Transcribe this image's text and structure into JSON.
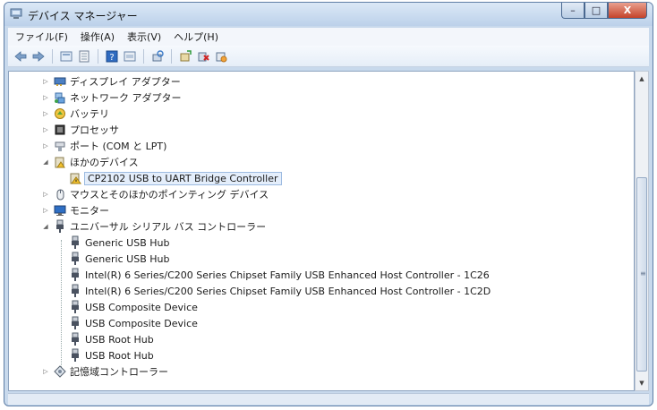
{
  "window": {
    "title": "デバイス マネージャー",
    "buttons": {
      "minimize": "–",
      "maximize": "□",
      "close": "X"
    }
  },
  "menu": [
    {
      "label": "ファイル(F)"
    },
    {
      "label": "操作(A)"
    },
    {
      "label": "表示(V)"
    },
    {
      "label": "ヘルプ(H)"
    }
  ],
  "toolbar": {
    "icons": [
      "back-arrow-icon",
      "forward-arrow-icon",
      "device-view-icon",
      "properties-icon",
      "help-icon",
      "device-list-icon",
      "scan-hardware-icon",
      "update-driver-icon",
      "uninstall-icon",
      "disable-device-icon"
    ]
  },
  "tree": {
    "display_adapters": "ディスプレイ アダプター",
    "network_adapters": "ネットワーク アダプター",
    "battery": "バッテリ",
    "processor": "プロセッサ",
    "ports": "ポート (COM と LPT)",
    "other_devices": "ほかのデバイス",
    "cp2102": "CP2102 USB to UART Bridge Controller",
    "mouse": "マウスとそのほかのポインティング デバイス",
    "monitor": "モニター",
    "usb_controllers": "ユニバーサル シリアル バス コントローラー",
    "usb_children": [
      "Generic USB Hub",
      "Generic USB Hub",
      "Intel(R) 6 Series/C200 Series Chipset Family USB Enhanced Host Controller - 1C26",
      "Intel(R) 6 Series/C200 Series Chipset Family USB Enhanced Host Controller - 1C2D",
      "USB Composite Device",
      "USB Composite Device",
      "USB Root Hub",
      "USB Root Hub"
    ],
    "storage_controllers": "記憶域コントローラー"
  },
  "scrollbar": {
    "up": "▲",
    "down": "▼",
    "grip": "≡"
  },
  "colors": {
    "selection": "#e4eefb",
    "window_frame": "#c8d9ec"
  }
}
